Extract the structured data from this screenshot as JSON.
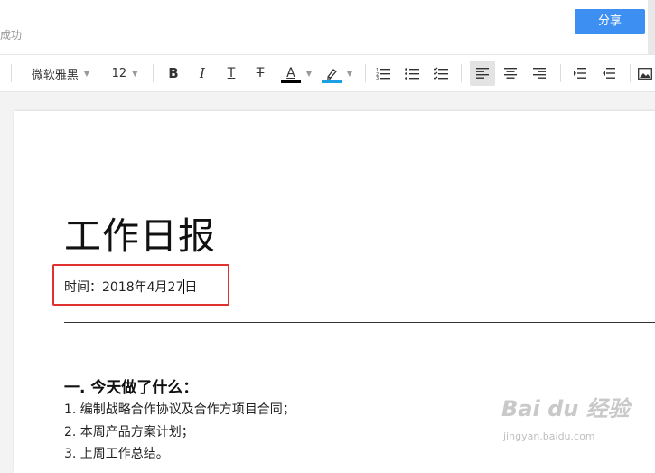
{
  "header": {
    "save_status": "成功",
    "share_label": "分享"
  },
  "toolbar": {
    "font_family": "微软雅黑",
    "font_size": "12",
    "bold": "B",
    "italic": "I",
    "underline": "T",
    "strikethrough": "T",
    "font_color_glyph": "A",
    "font_color": "#000000",
    "highlight_color": "#1ba1e2"
  },
  "document": {
    "title": "工作日报",
    "time_line_before_cursor": "时间：2018年4月27",
    "time_line_after_cursor": "日",
    "section_heading": "一. 今天做了什么：",
    "items": [
      "1. 编制战略合作协议及合作方项目合同；",
      "2. 本周产品方案计划；",
      "3. 上周工作总结。"
    ]
  },
  "annotation": {
    "highlight_color": "#e03030"
  },
  "watermark": {
    "brand": "Bai du 经验",
    "url": "jingyan.baidu.com"
  }
}
